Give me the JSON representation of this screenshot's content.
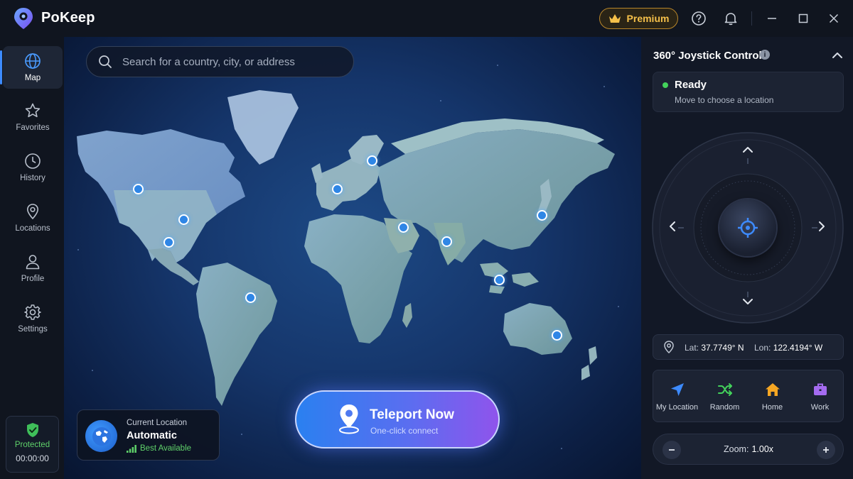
{
  "app": {
    "name": "PoKeep"
  },
  "titlebar": {
    "premium_label": "Premium"
  },
  "sidebar": {
    "items": [
      {
        "label": "Map",
        "icon": "globe-icon",
        "active": true
      },
      {
        "label": "Favorites",
        "icon": "star-icon"
      },
      {
        "label": "History",
        "icon": "clock-icon"
      },
      {
        "label": "Locations",
        "icon": "map-pin-icon"
      },
      {
        "label": "Profile",
        "icon": "user-icon"
      },
      {
        "label": "Settings",
        "icon": "gear-icon"
      }
    ],
    "protection": {
      "label": "Protected",
      "timer": "00:00:00"
    }
  },
  "map": {
    "search_placeholder": "Search for a country, city, or address",
    "current_location": {
      "label": "Current Location",
      "value": "Automatic",
      "quality": "Best Available"
    },
    "teleport": {
      "title": "Teleport Now",
      "subtitle": "One-click connect"
    }
  },
  "panel": {
    "title": "360° Joystick Control",
    "status": {
      "title": "Ready",
      "subtitle": "Move to choose a location",
      "color": "#43d25b"
    },
    "coordinates": {
      "lat_label": "Lat:",
      "lat_value": "37.7749° N",
      "lon_label": "Lon:",
      "lon_value": "122.4194° W"
    },
    "quick_actions": [
      {
        "label": "My Location",
        "icon": "navigation-arrow-icon",
        "color": "#3d8bff"
      },
      {
        "label": "Random",
        "icon": "shuffle-icon",
        "color": "#43d25b"
      },
      {
        "label": "Home",
        "icon": "home-icon",
        "color": "#f5a623"
      },
      {
        "label": "Work",
        "icon": "briefcase-icon",
        "color": "#a46bf0"
      }
    ],
    "zoom": {
      "label": "Zoom:",
      "value": "1.00x"
    }
  },
  "colors": {
    "accent": "#3d8bff",
    "premium": "#f5c04a",
    "success": "#5fd16a"
  }
}
